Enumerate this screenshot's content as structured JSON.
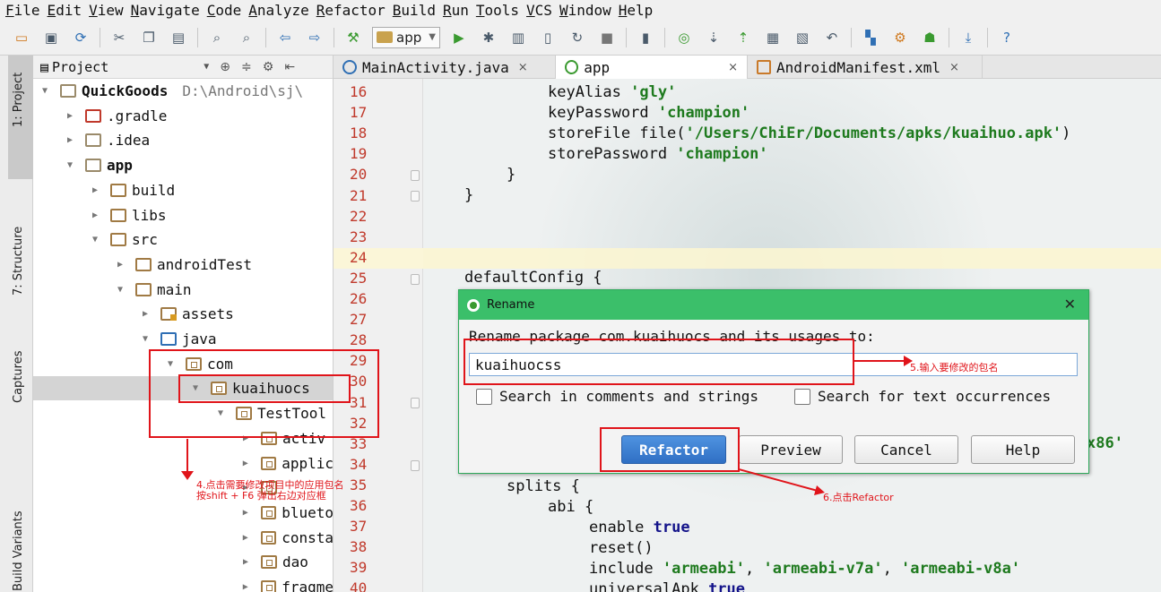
{
  "menu": [
    "File",
    "Edit",
    "View",
    "Navigate",
    "Code",
    "Analyze",
    "Refactor",
    "Build",
    "Run",
    "Tools",
    "VCS",
    "Window",
    "Help"
  ],
  "toolbar": {
    "run_config": "app",
    "icons": [
      "open-folder-icon",
      "save-icon",
      "sync-icon",
      "cut-icon",
      "copy-icon",
      "paste-icon",
      "find-icon",
      "replace-icon",
      "back-icon",
      "forward-icon",
      "make-project-icon",
      "run-icon",
      "debug-icon",
      "attach-icon",
      "stop-icon",
      "device-monitor-icon",
      "vcs-update-icon",
      "vcs-commit-icon",
      "sdk-manager-icon",
      "android-icon",
      "download-icon",
      "help-icon"
    ]
  },
  "stripe": {
    "project": "1: Project",
    "structure": "7: Structure",
    "captures": "Captures",
    "build_variants": "Build Variants"
  },
  "project_panel": {
    "title": "Project",
    "tree": [
      {
        "label": "QuickGoods",
        "path": "D:\\Android\\sj\\",
        "depth": 0,
        "expanded": true,
        "bold": true
      },
      {
        "label": ".gradle",
        "depth": 1,
        "expanded": false
      },
      {
        "label": ".idea",
        "depth": 1,
        "expanded": false
      },
      {
        "label": "app",
        "depth": 1,
        "expanded": true,
        "bold": true
      },
      {
        "label": "build",
        "depth": 2,
        "expanded": false
      },
      {
        "label": "libs",
        "depth": 2,
        "expanded": false
      },
      {
        "label": "src",
        "depth": 2,
        "expanded": true
      },
      {
        "label": "androidTest",
        "depth": 3,
        "expanded": false
      },
      {
        "label": "main",
        "depth": 3,
        "expanded": true
      },
      {
        "label": "assets",
        "depth": 4,
        "expanded": false
      },
      {
        "label": "java",
        "depth": 4,
        "expanded": true
      },
      {
        "label": "com",
        "depth": 5,
        "expanded": true
      },
      {
        "label": "kuaihuocs",
        "depth": 6,
        "expanded": true,
        "selected": true
      },
      {
        "label": "TestTool",
        "depth": 7,
        "expanded": true
      },
      {
        "label": "activ",
        "depth": 8,
        "expanded": false
      },
      {
        "label": "applic",
        "depth": 8,
        "expanded": false
      },
      {
        "label": "",
        "depth": 8,
        "expanded": false
      },
      {
        "label": "blueto",
        "depth": 8,
        "expanded": false
      },
      {
        "label": "consta",
        "depth": 8,
        "expanded": false
      },
      {
        "label": "dao",
        "depth": 8,
        "expanded": false
      },
      {
        "label": "fragme",
        "depth": 8,
        "expanded": false
      }
    ]
  },
  "tabs": [
    {
      "label": "MainActivity.java",
      "close": "×"
    },
    {
      "label": "app",
      "close": "×",
      "active": true
    },
    {
      "label": "AndroidManifest.xml",
      "close": "×"
    }
  ],
  "editor": {
    "line_numbers": [
      16,
      17,
      18,
      19,
      20,
      21,
      22,
      23,
      24,
      25,
      26,
      27,
      28,
      29,
      30,
      31,
      32,
      33,
      34,
      35,
      36,
      37,
      38,
      39,
      40
    ],
    "current_line": 24,
    "code": {
      "l16_a": "keyAlias ",
      "l16_b": "'gly'",
      "l17_a": "keyPassword ",
      "l17_b": "'champion'",
      "l18_a": "storeFile file(",
      "l18_b": "'/Users/ChiEr/Documents/apks/kuaihuo.apk'",
      "l18_c": ")",
      "l19_a": "storePassword ",
      "l19_b": "'champion'",
      "l20": "}",
      "l21": "}",
      "l25": "defaultConfig {",
      "l33_tail": "x86'",
      "l35": "splits {",
      "l36": "abi {",
      "l37_a": "enable ",
      "l37_b": "true",
      "l38": "reset()",
      "l39_a": "include ",
      "l39_b": "'armeabi'",
      "l39_c": ", ",
      "l39_d": "'armeabi-v7a'",
      "l39_e": ", ",
      "l39_f": "'armeabi-v8a'",
      "l40_a": "universalApk ",
      "l40_b": "true"
    }
  },
  "dialog": {
    "title": "Rename",
    "close": "✕",
    "prompt": "Rename package com.kuaihuocs and its usages to:",
    "value": "kuaihuocss",
    "search_comments": "Search in comments and strings",
    "search_text": "Search for text occurrences",
    "buttons": {
      "refactor": "Refactor",
      "preview": "Preview",
      "cancel": "Cancel",
      "help": "Help"
    }
  },
  "annotations": {
    "note4_line1": "4.点击需要修改项目中的应用包名",
    "note4_line2": "按shift + F6 弹出右边对应框",
    "note5": "5.输入要修改的包名",
    "note6": "6.点击Refactor",
    "color": "#e0141a"
  }
}
